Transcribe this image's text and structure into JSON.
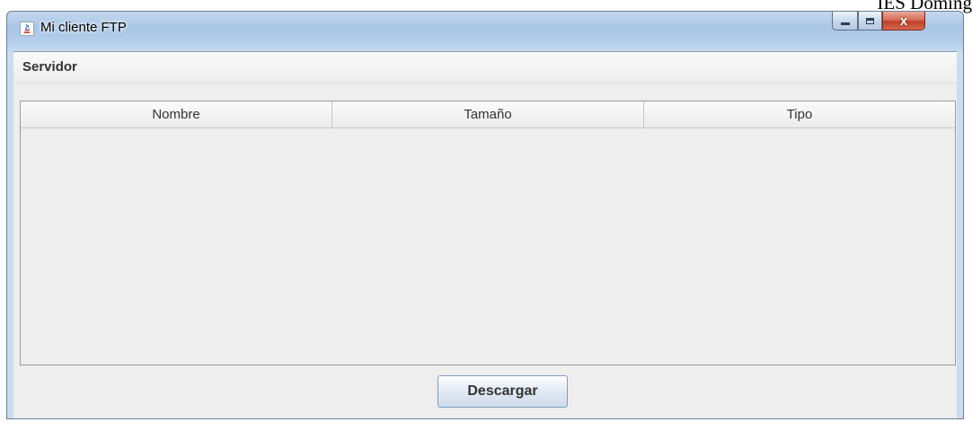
{
  "corner_text": "IES Doming",
  "window": {
    "title": "Mi cliente FTP",
    "app_icon": "java-icon",
    "controls": {
      "minimize_icon": "minimize-icon",
      "maximize_icon": "maximize-icon",
      "close_icon": "close-icon",
      "close_glyph": "x"
    }
  },
  "menu": {
    "items": [
      {
        "label": "Servidor"
      }
    ]
  },
  "table": {
    "columns": [
      "Nombre",
      "Tamaño",
      "Tipo"
    ],
    "rows": []
  },
  "actions": {
    "download_label": "Descargar"
  },
  "colors": {
    "titlebar": "#a9c6e6",
    "close_button": "#c0412a",
    "panel_background": "#eeeeee"
  }
}
